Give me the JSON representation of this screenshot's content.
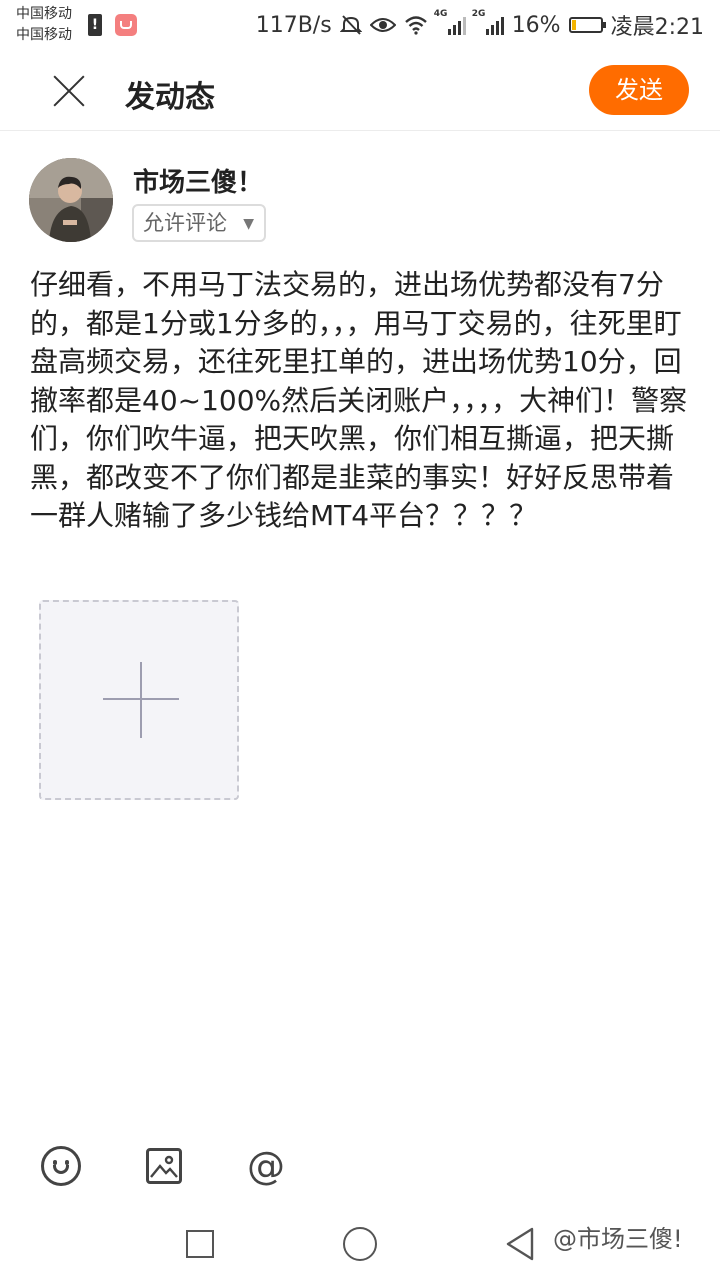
{
  "status_bar": {
    "carrier_1": "中国移动",
    "carrier_2": "中国移动",
    "net_speed": "117B/s",
    "signal_tag_1": "4G",
    "signal_tag_2": "2G",
    "battery": "16%",
    "time": "凌晨2:21",
    "battery_level": 0.16,
    "icons": [
      "alert-icon",
      "app-notification-icon",
      "mute-icon",
      "eye-icon",
      "wifi-icon",
      "signal-4g-icon",
      "signal-2g-icon",
      "battery-icon"
    ]
  },
  "header": {
    "title": "发动态",
    "send_label": "发送",
    "accent_color": "#ff6c00"
  },
  "user": {
    "name": "市场三傻！",
    "comment_permission": "允许评论"
  },
  "post": {
    "text": "仔细看，不用马丁法交易的，进出场优势都没有7分的，都是1分或1分多的，，，用马丁交易的，往死里盯盘高频交易，还往死里扛单的，进出场优势10分，回撤率都是40~100%然后关闭账户，，，，大神们！警察们，你们吹牛逼，把天吹黑，你们相互撕逼，把天撕黑，都改变不了你们都是韭菜的事实！好好反思带着一群人赌输了多少钱给MT4平台？？？？"
  },
  "toolbar": {
    "icons": [
      "emoji-icon",
      "image-icon",
      "at-icon"
    ],
    "at_symbol": "@"
  },
  "watermark": "@市场三傻!"
}
